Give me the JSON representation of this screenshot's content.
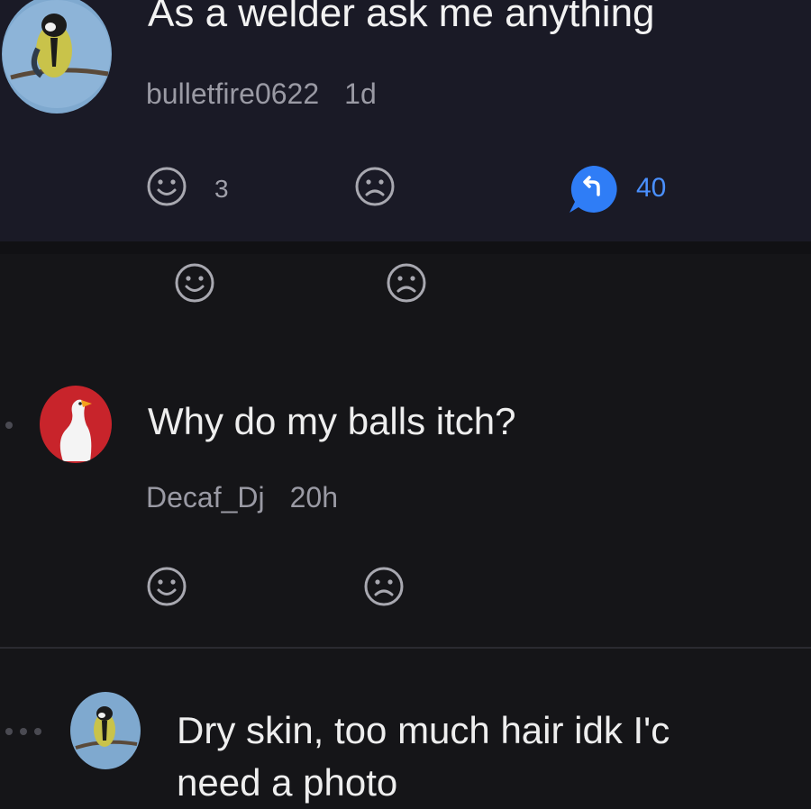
{
  "post": {
    "title": "As a welder ask me anything",
    "author": "bulletfire0622",
    "age": "1d",
    "upvote_icon": "smile-icon",
    "upvote_count": "3",
    "downvote_icon": "frown-icon",
    "reply_icon": "reply-bubble-icon",
    "reply_count": "40",
    "reply_color": "#2f7df6"
  },
  "post_reactions": {
    "upvote_icon": "smile-icon",
    "downvote_icon": "frown-icon"
  },
  "comments": [
    {
      "author": "Decaf_Dj",
      "age": "20h",
      "text": "Why do my balls itch?",
      "avatar": "goose-avatar",
      "avatar_color": "#c8242b"
    },
    {
      "text_line1": "Dry skin, too much hair idk I'c",
      "text_line2": "need a photo",
      "avatar": "bird-avatar"
    }
  ]
}
